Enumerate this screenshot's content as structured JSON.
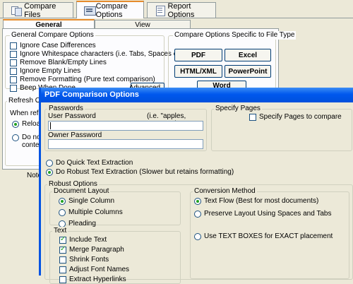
{
  "app": {
    "tabs": [
      {
        "label": "Compare Files",
        "icon": "compare-files-icon"
      },
      {
        "label": "Compare Options",
        "icon": "options-icon"
      },
      {
        "label": "Report Options",
        "icon": "report-icon"
      }
    ],
    "subtabs": [
      "General",
      "View"
    ],
    "general_group": {
      "title": "General Compare Options",
      "options": [
        {
          "label": "Ignore Case Differences"
        },
        {
          "label": "Ignore Whitespace characters (i.e. Tabs, Spaces etc.)"
        },
        {
          "label": "Remove Blank/Empty Lines"
        },
        {
          "label": "Ignore Empty Lines"
        },
        {
          "label": "Remove Formatting (Pure text comparison)"
        },
        {
          "label": "Beep When Done"
        }
      ],
      "advanced_button": "Advanced..."
    },
    "filetype_group": {
      "title": "Compare Options Specific to File Type",
      "buttons": [
        "PDF",
        "Excel",
        "HTML/XML",
        "PowerPoint",
        "Word"
      ]
    },
    "refresh_group": {
      "title": "Refresh Options",
      "when_label": "When refres",
      "option1": "Reload",
      "option2_line1": "Do not r",
      "option2_line2": "content"
    },
    "note_label": "Note"
  },
  "dialog": {
    "title": "PDF Comparison Options",
    "passwords": {
      "title": "Passwords",
      "user_label": "User Password",
      "hint": "(i.e. \"apples, oranges\")",
      "user_value": "",
      "owner_label": "Owner Password",
      "owner_value": ""
    },
    "pages": {
      "title": "Specify Pages",
      "checkbox": "Specify Pages to compare"
    },
    "extraction": [
      {
        "label": "Do Quick Text Extraction",
        "checked": false
      },
      {
        "label": "Do Robust Text Extraction (Slower but retains formatting)",
        "checked": true
      }
    ],
    "robust": {
      "title": "Robust Options",
      "layout": {
        "title": "Document Layout",
        "options": [
          {
            "label": "Single Column",
            "checked": true
          },
          {
            "label": "Multiple Columns",
            "checked": false
          },
          {
            "label": "Pleading",
            "checked": false
          }
        ]
      },
      "text": {
        "title": "Text",
        "options": [
          {
            "label": "Include Text",
            "checked": true
          },
          {
            "label": "Merge Paragraph",
            "checked": true
          },
          {
            "label": "Shrink Fonts",
            "checked": false
          },
          {
            "label": "Adjust Font Names",
            "checked": false
          },
          {
            "label": "Extract Hyperlinks",
            "checked": false
          }
        ]
      },
      "conversion": {
        "title": "Conversion Method",
        "options": [
          {
            "label": "Text Flow (Best for most documents)",
            "checked": true
          },
          {
            "label": "Preserve Layout Using Spaces and Tabs",
            "checked": false
          },
          {
            "label": "Use TEXT BOXES for EXACT placement",
            "checked": false
          }
        ]
      }
    }
  }
}
